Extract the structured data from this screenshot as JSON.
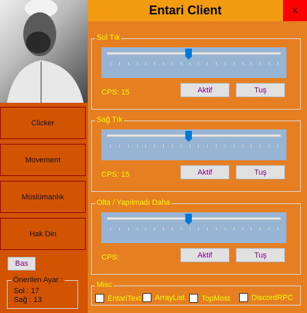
{
  "header": {
    "title": "Entari Client",
    "close_label": "X"
  },
  "sidebar": {
    "nav": [
      "Clicker",
      "Movement",
      "Müslümanlık",
      "Hak Din"
    ],
    "bas_label": "Bas",
    "recommended": {
      "legend": "Önerilen Ayar :",
      "lines": [
        "Sol : 17",
        "Sağ : 13"
      ]
    }
  },
  "groups": [
    {
      "legend": "Sol Tık",
      "cps": "CPS: 15",
      "slider_fraction": 0.47,
      "aktif": "Aktif",
      "tus": "Tuş"
    },
    {
      "legend": "Sağ Tık",
      "cps": "CPS: 15",
      "slider_fraction": 0.47,
      "aktif": "Aktif",
      "tus": "Tuş"
    },
    {
      "legend": "Olta / Yapılmadı Daha",
      "cps": "CPS:",
      "slider_fraction": 0.47,
      "aktif": "Aktif",
      "tus": "Tuş"
    }
  ],
  "misc": {
    "legend": "Misc",
    "options": [
      {
        "label": "EntariText",
        "checked": false
      },
      {
        "label": "ArrayList",
        "checked": false
      },
      {
        "label": "TopMost",
        "checked": false
      },
      {
        "label": "DiscordRPC",
        "checked": false
      }
    ]
  }
}
